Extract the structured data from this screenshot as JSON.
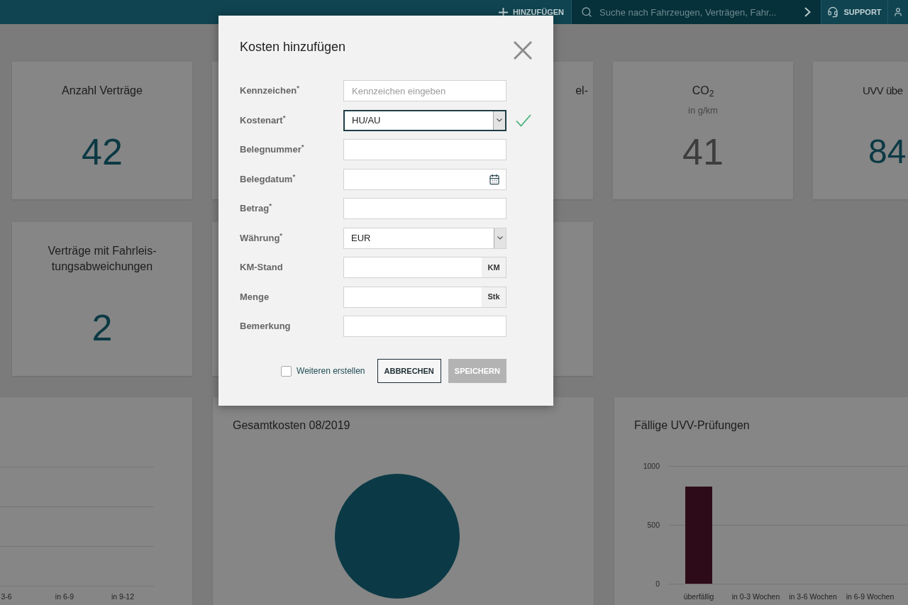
{
  "top_bar": {
    "add_button": {
      "label": "HINZUFÜGEN"
    },
    "search": {
      "placeholder": "Suche nach Fahrzeugen, Verträgen, Fahr..."
    },
    "support_button": {
      "label": "SUPPORT"
    }
  },
  "kpi_rows": [
    {
      "cards": [
        {
          "kind": "metric",
          "title": "Anzahl Verträge",
          "value": "42",
          "color": "#0b3944"
        },
        {
          "kind": "covered"
        },
        {
          "kind": "cropped_left",
          "title": "el-"
        },
        {
          "kind": "metric",
          "title": "CO$_{2}$",
          "subtitle": "in g/km",
          "value": "41",
          "color": "#3d3d3d"
        },
        {
          "kind": "cropped_right",
          "title": "UVV übe",
          "value": "84",
          "color": "#0b3944"
        }
      ]
    },
    {
      "cards": [
        {
          "kind": "metric",
          "title": "Verträge mit Fahrleis-tungsabweichungen",
          "value": "2",
          "color": "#0b3944"
        },
        {
          "kind": "covered"
        },
        {
          "kind": "covered"
        }
      ]
    }
  ],
  "chart_cards": [
    {
      "kind": "grid",
      "axis_labels": [
        "3-6",
        "in 6-9",
        "in 9-12"
      ]
    },
    {
      "kind": "pie",
      "title": "Gesamtkosten 08/2019"
    },
    {
      "kind": "bar",
      "chart_data": {
        "type": "bar",
        "title": "Fällige UVV-Prüfungen",
        "categories": [
          "überfällig",
          "in 0-3 Wochen",
          "in 3-6 Wochen",
          "in 6-9 Wochen"
        ],
        "values": [
          825,
          0,
          0,
          0
        ],
        "ylim": [
          0,
          1000
        ],
        "yticks": [
          0,
          500,
          1000
        ]
      }
    }
  ],
  "dialog": {
    "title": "Kosten hinzufügen",
    "fields": [
      {
        "kind": "text",
        "label": "Kennzeichen$^{*}$",
        "placeholder": "Kennzeichen eingeben",
        "focused": false,
        "valid": false
      },
      {
        "kind": "select",
        "label": "Kostenart$^{*}$",
        "value": "HU/AU",
        "focused": true,
        "valid": true
      },
      {
        "kind": "text",
        "label": "Belegnummer$^{*}$",
        "focused": false,
        "valid": false
      },
      {
        "kind": "date",
        "label": "Belegdatum$^{*}$",
        "focused": false,
        "valid": false
      },
      {
        "kind": "text",
        "label": "Betrag$^{*}$",
        "focused": false,
        "valid": false
      },
      {
        "kind": "select",
        "label": "Währung$^{*}$",
        "value": "EUR",
        "focused": false,
        "valid": false
      },
      {
        "kind": "unit",
        "label": "KM-Stand",
        "unit": "KM",
        "focused": false,
        "valid": false
      },
      {
        "kind": "unit",
        "label": "Menge",
        "unit": "Stk",
        "focused": false,
        "valid": false
      },
      {
        "kind": "text",
        "label": "Bemerkung",
        "focused": false,
        "valid": false
      }
    ],
    "create_another": {
      "label": "Weiteren erstellen",
      "checked": false
    },
    "buttons": [
      {
        "label": "ABBRECHEN",
        "kind": "secondary",
        "disabled": false
      },
      {
        "label": "SPEICHERN",
        "kind": "primary",
        "disabled": true
      }
    ]
  }
}
